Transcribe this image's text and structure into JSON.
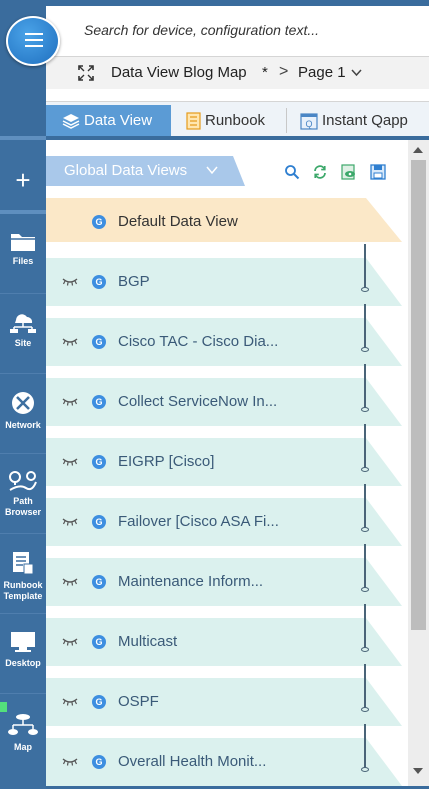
{
  "search": {
    "placeholder": "Search for device, configuration text..."
  },
  "breadcrumb": {
    "map_name": "Data View Blog Map",
    "modified_mark": "*",
    "separator": ">",
    "page": "Page 1"
  },
  "tabs": [
    {
      "label": "Data View",
      "icon": "layers-icon",
      "active": true
    },
    {
      "label": "Runbook",
      "icon": "runbook-icon",
      "active": false
    },
    {
      "label": "Instant Qapp",
      "icon": "qapp-icon",
      "active": false
    }
  ],
  "sidebar": {
    "add_label": "+",
    "items": [
      {
        "label": "Files",
        "icon": "folder-icon"
      },
      {
        "label": "Site",
        "icon": "site-icon"
      },
      {
        "label": "Network",
        "icon": "network-icon"
      },
      {
        "label": "Path Browser",
        "icon": "path-icon"
      },
      {
        "label": "Runbook Template",
        "icon": "runbook-template-icon"
      },
      {
        "label": "Desktop",
        "icon": "desktop-icon"
      },
      {
        "label": "Map",
        "icon": "map-icon"
      }
    ]
  },
  "panel": {
    "section_title": "Global Data Views",
    "tools": [
      "search-icon",
      "refresh-icon",
      "view-icon",
      "save-icon"
    ],
    "badge": "G",
    "default_view": "Default Data View",
    "views": [
      "BGP",
      "Cisco TAC - Cisco Dia...",
      "Collect ServiceNow In...",
      "EIGRP [Cisco]",
      "Failover [Cisco ASA Fi...",
      "Maintenance Inform...",
      "Multicast",
      "OSPF",
      "Overall Health Monit..."
    ]
  },
  "colors": {
    "rail": "#3d6fa0",
    "active_tab": "#5b9bd5",
    "row": "#dbf1ee",
    "default_row": "#fbe8c8"
  }
}
